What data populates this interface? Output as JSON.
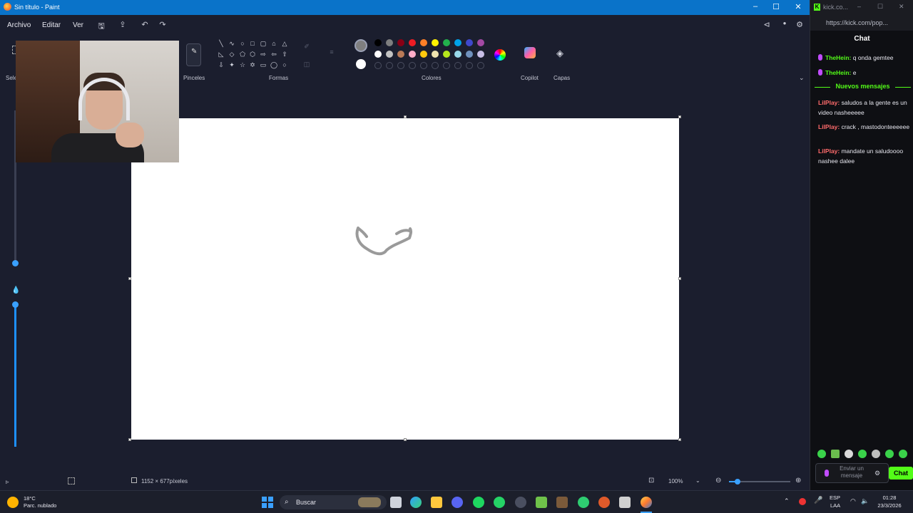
{
  "paint": {
    "title": "Sin título - Paint",
    "menu": {
      "file": "Archivo",
      "edit": "Editar",
      "view": "Ver"
    },
    "ribbon": {
      "brushes_label": "Pinceles",
      "shapes_label": "Formas",
      "colors_label": "Colores",
      "copilot_label": "Copilot",
      "layers_label": "Capas",
      "select_label": "Sele"
    },
    "palette_row1": [
      "#000000",
      "#7f7f7f",
      "#880015",
      "#ed1c24",
      "#ff7f27",
      "#fff200",
      "#22b14c",
      "#00a2e8",
      "#3f48cc",
      "#a349a4"
    ],
    "palette_row2": [
      "#ffffff",
      "#c3c3c3",
      "#b97a57",
      "#ffaec9",
      "#ffc90e",
      "#efe4b0",
      "#b5e61d",
      "#99d9ea",
      "#7092be",
      "#c8bfe7"
    ],
    "primary_color": "#7f7f7f",
    "secondary_color": "#ffffff",
    "status": {
      "canvas_size": "1152 × 677píxeles",
      "zoom": "100%"
    }
  },
  "chat": {
    "tab_title": "kick.co...",
    "url": "https://kick.com/pop...",
    "title": "Chat",
    "messages_old": [
      {
        "user": "TheHein:",
        "text": "q onda gemtee"
      },
      {
        "user": "TheHein:",
        "text": "e"
      }
    ],
    "new_messages_label": "Nuevos mensajes",
    "messages_new": [
      {
        "user": "LilPlay:",
        "text": "saludos a la gente es un video nasheeeee"
      },
      {
        "user": "LilPlay:",
        "text": "crack , mastodonteeeeee"
      },
      {
        "user": "LilPlay:",
        "text": "mandate un saludoooo nashee dalee"
      }
    ],
    "input_placeholder": "Enviar un mensaje",
    "send_button": "Chat"
  },
  "taskbar": {
    "weather_temp": "18°C",
    "weather_desc": "Parc. nublado",
    "search_label": "Buscar",
    "lang1": "ESP",
    "lang2": "LAA",
    "time": "01:28",
    "date": "23/3/2026"
  },
  "icons": [
    "search-icon",
    "save-icon",
    "share-icon",
    "undo-icon",
    "redo-icon",
    "settings-icon",
    "windows-start-icon",
    "wifi-icon",
    "volume-icon",
    "mic-icon"
  ]
}
